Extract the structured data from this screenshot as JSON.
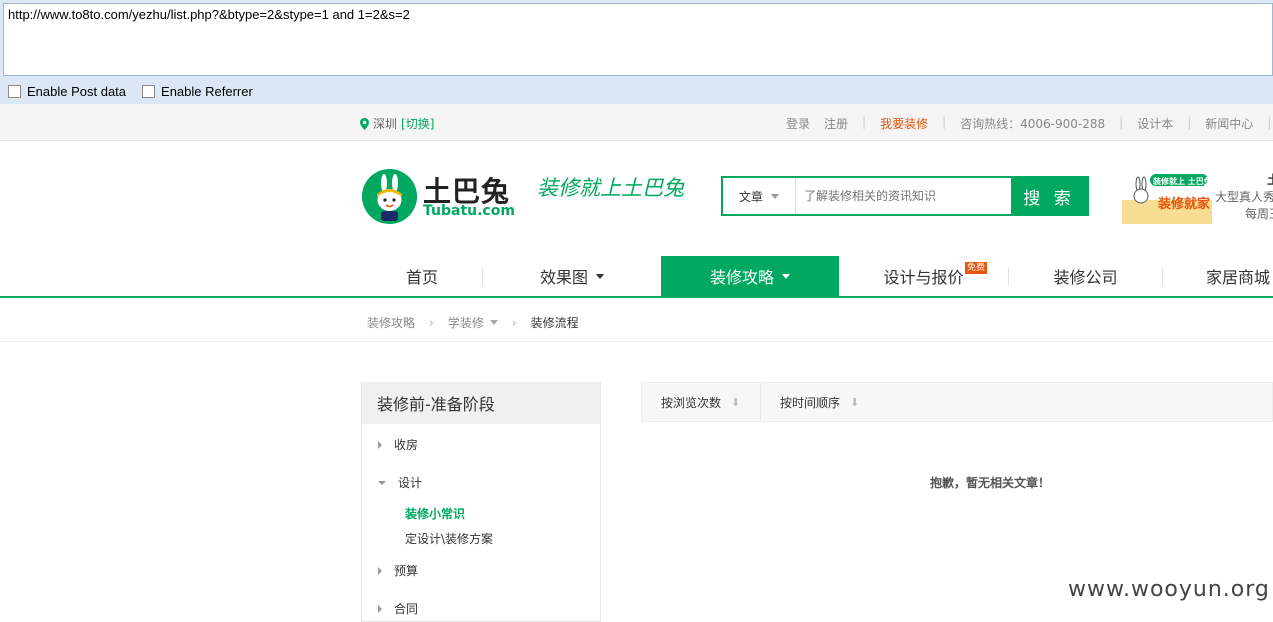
{
  "hackbar": {
    "url": "http://www.to8to.com/yezhu/list.php?&btype=2&stype=1 and 1=2&s=2",
    "enable_post": "Enable Post data",
    "enable_referrer": "Enable Referrer"
  },
  "topbar": {
    "city": "深圳",
    "switch": "[切换]",
    "links": [
      "登录",
      "注册",
      "我要装修",
      "咨询热线：4006-900-288",
      "设计本",
      "新闻中心"
    ]
  },
  "header": {
    "logo_cn": "土巴兔",
    "logo_en": "Tubatu.com",
    "slogan": "装修就上土巴兔",
    "search_type": "文章",
    "search_placeholder": "了解装修相关的资讯知识",
    "search_button": "搜 索",
    "promo_badge": "装修就上 土巴兔",
    "promo_side": "土",
    "promo_line2": "大型真人秀",
    "promo_line3": "每周王"
  },
  "nav": {
    "items": [
      "首页",
      "效果图",
      "装修攻略",
      "设计与报价",
      "装修公司",
      "家居商城"
    ],
    "free_badge": "免费"
  },
  "breadcrumb": {
    "items": [
      "装修攻略",
      "学装修",
      "装修流程"
    ]
  },
  "sidebar": {
    "title": "装修前-准备阶段",
    "items": [
      "收房",
      "设计",
      "预算",
      "合同"
    ],
    "sub_items": [
      "装修小常识",
      "定设计\\装修方案"
    ]
  },
  "sort": {
    "by_views": "按浏览次数",
    "by_time": "按时间顺序",
    "arrow": "⬇"
  },
  "empty_message": "抱歉，暂无相关文章！",
  "watermark": "www.wooyun.org",
  "colors": {
    "brand_green": "#00a95f",
    "accent_orange": "#e8530e"
  }
}
